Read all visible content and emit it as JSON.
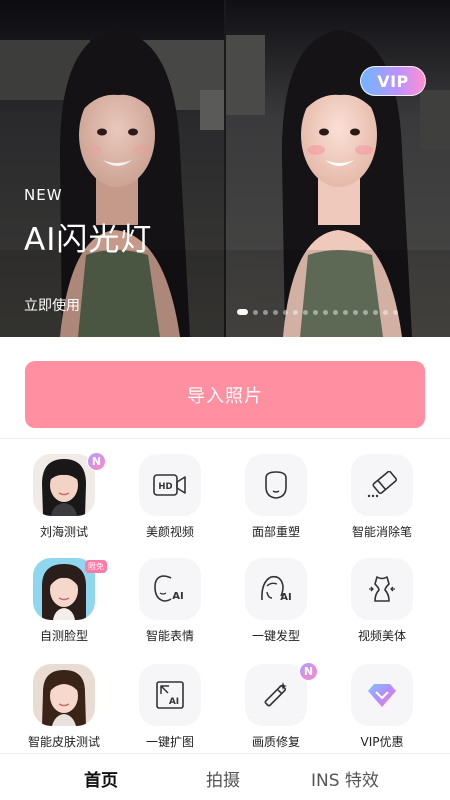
{
  "banner": {
    "vip_badge": "VIP",
    "tag": "NEW",
    "title": "AI闪光灯",
    "cta": "立即使用",
    "page_count": 16,
    "active_page": 0
  },
  "import_button": {
    "label": "导入照片"
  },
  "tools": [
    {
      "label": "刘海测试",
      "icon": "bangs-portrait-thumbnail",
      "badge": "N"
    },
    {
      "label": "美颜视频",
      "icon": "hd-video-icon"
    },
    {
      "label": "面部重塑",
      "icon": "face-outline-icon"
    },
    {
      "label": "智能消除笔",
      "icon": "eraser-icon"
    },
    {
      "label": "自测脸型",
      "icon": "face-shape-portrait-thumbnail",
      "badge": "限免"
    },
    {
      "label": "智能表情",
      "icon": "ai-face-icon",
      "icon_text": "AI"
    },
    {
      "label": "一键发型",
      "icon": "ai-hair-icon",
      "icon_text": "AI"
    },
    {
      "label": "视频美体",
      "icon": "body-shape-icon"
    },
    {
      "label": "智能皮肤测试",
      "icon": "skin-portrait-thumbnail"
    },
    {
      "label": "一键扩图",
      "icon": "ai-expand-icon",
      "icon_text": "AI"
    },
    {
      "label": "画质修复",
      "icon": "magic-wand-icon",
      "badge": "N"
    },
    {
      "label": "VIP优惠",
      "icon": "vip-diamond-icon"
    }
  ],
  "bottom_nav": [
    {
      "label": "首页",
      "active": true
    },
    {
      "label": "拍摄",
      "active": false
    },
    {
      "label": "INS 特效",
      "active": false
    }
  ],
  "colors": {
    "import_button": "#ff8fa1",
    "badge_gradient_start": "#b39bff",
    "badge_gradient_end": "#ff86c8"
  }
}
